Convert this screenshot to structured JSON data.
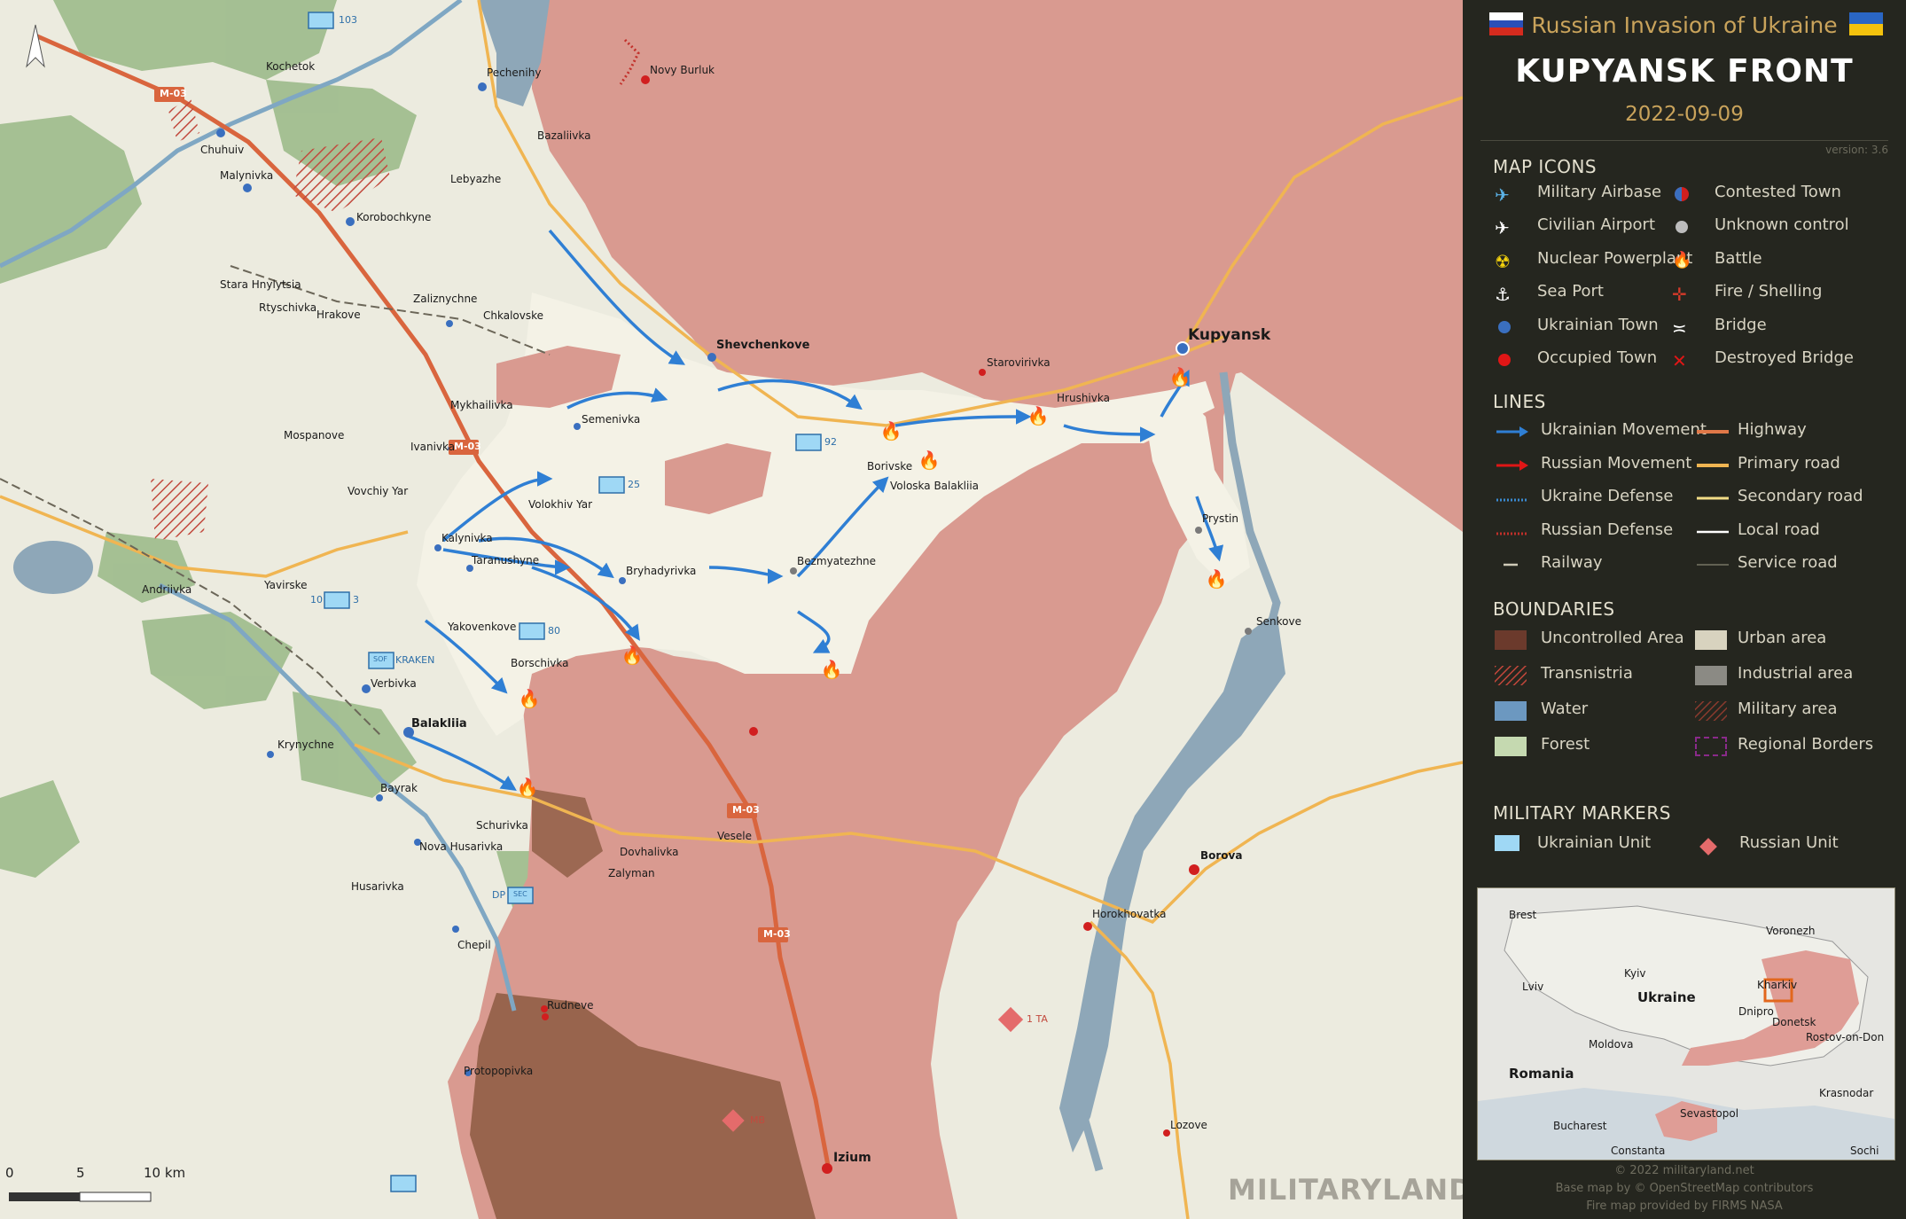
{
  "header": {
    "subtitle": "Russian Invasion of Ukraine",
    "title": "KUPYANSK FRONT",
    "date": "2022-09-09",
    "version": "version: 3.6"
  },
  "legend": {
    "map_icons_title": "MAP ICONS",
    "map_icons": [
      {
        "label": "Military Airbase",
        "icon": "plane-icon"
      },
      {
        "label": "Contested Town",
        "icon": "contested-town-icon"
      },
      {
        "label": "Civilian Airport",
        "icon": "airport-icon"
      },
      {
        "label": "Unknown control",
        "icon": "unknown-control-icon"
      },
      {
        "label": "Nuclear Powerplant",
        "icon": "nuclear-icon"
      },
      {
        "label": "Battle",
        "icon": "battle-fire-icon"
      },
      {
        "label": "Sea Port",
        "icon": "anchor-icon"
      },
      {
        "label": "Fire / Shelling",
        "icon": "shelling-icon"
      },
      {
        "label": "Ukrainian Town",
        "icon": "blue-dot-icon"
      },
      {
        "label": "Bridge",
        "icon": "bridge-icon"
      },
      {
        "label": "Occupied Town",
        "icon": "red-dot-icon"
      },
      {
        "label": "Destroyed Bridge",
        "icon": "destroyed-bridge-icon"
      }
    ],
    "lines_title": "LINES",
    "lines": [
      {
        "label": "Ukrainian Movement"
      },
      {
        "label": "Highway"
      },
      {
        "label": "Russian Movement"
      },
      {
        "label": "Primary road"
      },
      {
        "label": "Ukraine Defense"
      },
      {
        "label": "Secondary road"
      },
      {
        "label": "Russian Defense"
      },
      {
        "label": "Local road"
      },
      {
        "label": "Railway"
      },
      {
        "label": "Service road"
      }
    ],
    "boundaries_title": "BOUNDARIES",
    "boundaries": [
      {
        "label": "Uncontrolled Area"
      },
      {
        "label": "Urban area"
      },
      {
        "label": "Transnistria"
      },
      {
        "label": "Industrial area"
      },
      {
        "label": "Water"
      },
      {
        "label": "Military area"
      },
      {
        "label": "Forest"
      },
      {
        "label": "Regional Borders"
      }
    ],
    "markers_title": "MILITARY MARKERS",
    "markers": [
      {
        "label": "Ukrainian Unit"
      },
      {
        "label": "Russian Unit"
      }
    ]
  },
  "inset": {
    "labels": [
      "Brest",
      "Voronezh",
      "Kyiv",
      "Lviv",
      "Ukraine",
      "Kharkiv",
      "Dnipro",
      "Donetsk",
      "Rostov-on-Don",
      "Moldova",
      "Romania",
      "Sevastopol",
      "Krasnodar",
      "Bucharest",
      "Constanta",
      "Sochi"
    ]
  },
  "credits": {
    "line1": "© 2022 militaryland.net",
    "line2": "Base map by © OpenStreetMap contributors",
    "line3": "Fire map provided by FIRMS NASA"
  },
  "watermark": "MILITARYLAND",
  "scale": {
    "labels": [
      "0",
      "5",
      "10 km"
    ]
  },
  "towns": {
    "kupyansk": "Kupyansk",
    "shevchenkove": "Shevchenkove",
    "balakliia": "Balakliia",
    "izium": "Izium",
    "chuhuiv": "Chuhuiv",
    "malynivka": "Malynivka",
    "kochetok": "Kochetok",
    "pechenihy": "Pechenihy",
    "novy_burluk": "Novy Burluk",
    "bazaliivka": "Bazaliivka",
    "lebyazhe": "Lebyazhe",
    "korobochkyne": "Korobochkyne",
    "stara_hnylytsia": "Stara Hnylytsia",
    "rtyschivka": "Rtyschivka",
    "hrakove": "Hrakove",
    "zaliznychne": "Zaliznychne",
    "chkalovske": "Chkalovske",
    "mykhailivka": "Mykhailivka",
    "semenivka": "Semenivka",
    "mospanove": "Mospanove",
    "ivanivka": "Ivanivka",
    "vovchiy_yar": "Vovchiy Yar",
    "volokhiv_yar": "Volokhiv Yar",
    "kalynivka": "Kalynivka",
    "taranushyne": "Taranushyne",
    "bryhadyrivka": "Bryhadyrivka",
    "bezmyatezhne": "Bezmyatezhne",
    "borivske": "Borivske",
    "voloska_balakliia": "Voloska Balakliia",
    "starovirivka": "Starovirivka",
    "hrushivka": "Hrushivka",
    "prystin": "Prystin",
    "senkove": "Senkove",
    "andriivka": "Andriivka",
    "yavirske": "Yavirske",
    "yakovenkove": "Yakovenkove",
    "borschivka": "Borschivka",
    "verbivka": "Verbivka",
    "krynychne": "Krynychne",
    "bayrak": "Bayrak",
    "schurivka": "Schurivka",
    "nova_husarivka": "Nova Husarivka",
    "dovhalivka": "Dovhalivka",
    "zalyman": "Zalyman",
    "husarivka": "Husarivka",
    "chepil": "Chepil",
    "rudneve": "Rudneve",
    "protopopivka": "Protopopivka",
    "vesele": "Vesele",
    "borova": "Borova",
    "horokhovatka": "Horokhovatka",
    "lozove": "Lozove"
  },
  "roads": {
    "m03": "M-03"
  },
  "units": {
    "u103": "103",
    "u92": "92",
    "u25": "25",
    "u10": "10",
    "u3": "3",
    "u80": "80",
    "kraken": "KRAKEN",
    "sof": "SOF",
    "dp": "DP",
    "sec": "SEC",
    "ta1": "1 TA",
    "mb": "MB"
  },
  "colors": {
    "russian_area": "#d99a90",
    "ukraine_land": "#ecebdf",
    "liberated": "#f3f1e6",
    "uncontrolled": "#8a5a40",
    "water": "#8aa6b8",
    "forest": "#7fa36a",
    "ukr_arrow": "#2f7fd4",
    "highway": "#e07848",
    "primary": "#f0b552"
  }
}
